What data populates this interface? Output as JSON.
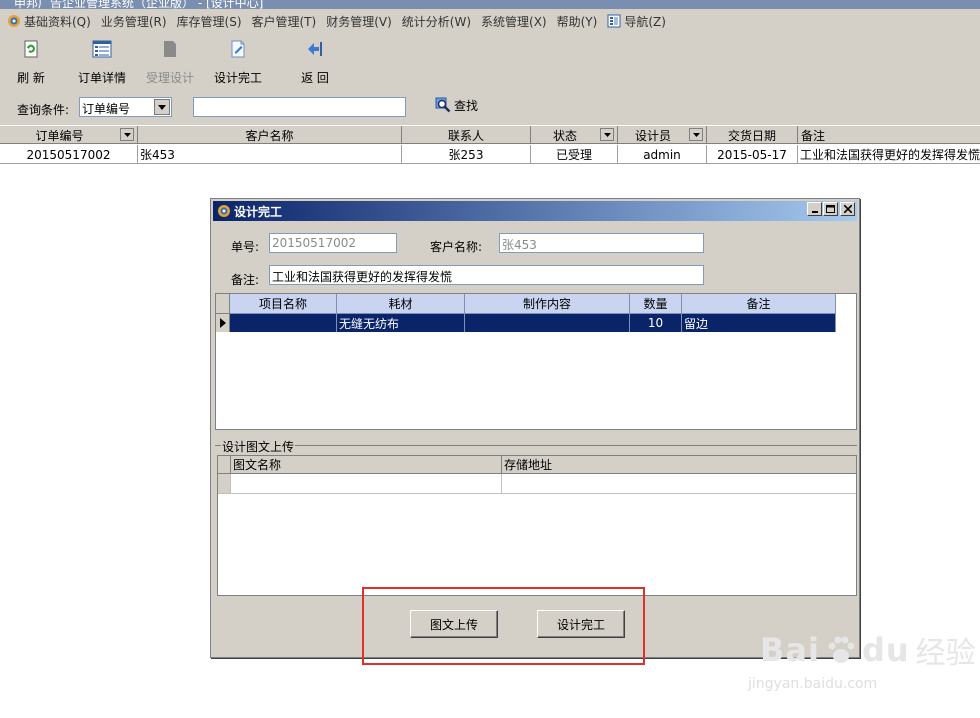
{
  "app": {
    "title": "申邦广告企业管理系统（企业版） - [设计中心]"
  },
  "menu": [
    {
      "label": "基础资料(Q)"
    },
    {
      "label": "业务管理(R)"
    },
    {
      "label": "库存管理(S)"
    },
    {
      "label": "客户管理(T)"
    },
    {
      "label": "财务管理(V)"
    },
    {
      "label": "统计分析(W)"
    },
    {
      "label": "系统管理(X)"
    },
    {
      "label": "帮助(Y)"
    },
    {
      "label": "导航(Z)"
    }
  ],
  "toolbar": {
    "refresh": "刷 新",
    "order_detail": "订单详情",
    "accept_design": "受理设计",
    "finish_design": "设计完工",
    "back": "返 回"
  },
  "query": {
    "label": "查询条件:",
    "field": "订单编号",
    "value": "",
    "search": "查找"
  },
  "orders": {
    "columns": [
      "订单编号",
      "客户名称",
      "联系人",
      "状态",
      "设计员",
      "交货日期",
      "备注"
    ],
    "rows": [
      {
        "order_no": "20150517002",
        "customer": "张453",
        "contact": "张253",
        "status": "已受理",
        "designer": "admin",
        "delivery_date": "2015-05-17",
        "remark": "工业和法国获得更好的发挥得发慌"
      }
    ]
  },
  "dialog": {
    "title": "设计完工",
    "order_no_label": "单号:",
    "order_no": "20150517002",
    "customer_label": "客户名称:",
    "customer": "张453",
    "remark_label": "备注:",
    "remark": "工业和法国获得更好的发挥得发慌",
    "items": {
      "columns": [
        "项目名称",
        "耗材",
        "制作内容",
        "数量",
        "备注"
      ],
      "rows": [
        {
          "name": "",
          "material": "无缝无纺布",
          "content": "",
          "qty": "10",
          "note": "留边"
        }
      ]
    },
    "upload_group": "设计图文上传",
    "upload_columns": [
      "图文名称",
      "存储地址"
    ],
    "upload_button": "图文上传",
    "finish_button": "设计完工"
  },
  "watermark": {
    "brand": "Bai",
    "brand2": "du",
    "cn": "经验",
    "url": "jingyan.baidu.com"
  },
  "colors": {
    "accent": "#0a246a",
    "highlight": "#e0302a",
    "chrome": "#d4d0c8"
  }
}
